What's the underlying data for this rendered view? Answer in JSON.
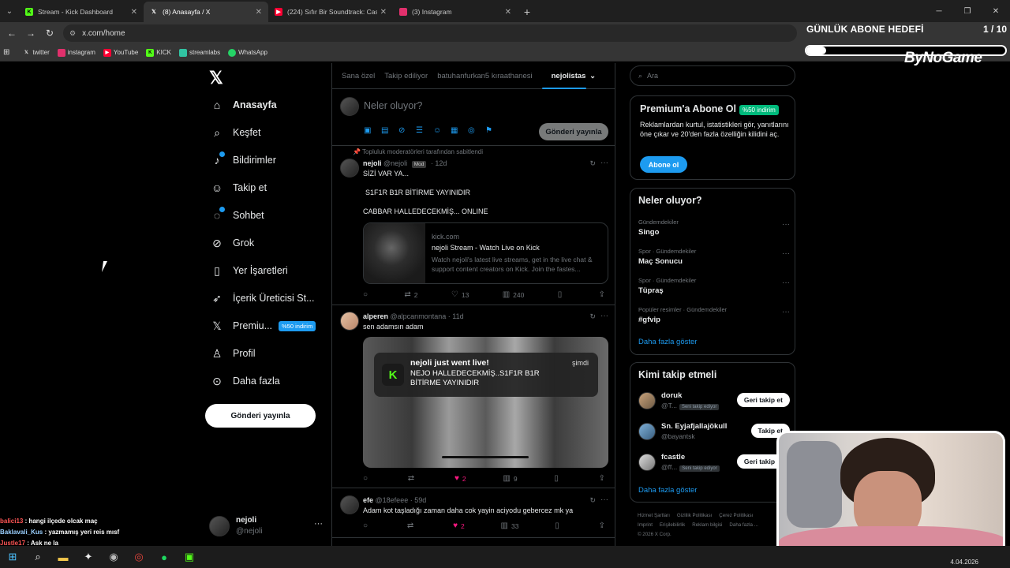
{
  "browser": {
    "tabs": [
      {
        "title": "Stream - Kick Dashboard",
        "icon": "kick-icon",
        "color": "#53fc18"
      },
      {
        "title": "(8) Anasayfa / X",
        "icon": "x-logo-icon",
        "color": "#ffffff"
      },
      {
        "title": "(224) Sıfır Bir Soundtrack: Cash",
        "icon": "youtube-icon",
        "color": "#ff0033"
      },
      {
        "title": "(3) Instagram",
        "icon": "instagram-icon",
        "color": "#e1306c"
      }
    ],
    "url": "x.com/home",
    "bookmarks": [
      "twitter",
      "instagram",
      "YouTube",
      "KICK",
      "streamlabs",
      "WhatsApp"
    ]
  },
  "overlay": {
    "goal_title": "GÜNLÜK ABONE HEDEFİ",
    "goal_count": "1 / 10",
    "goal_progress": 0.1,
    "brand": "ByNoGame"
  },
  "x": {
    "nav": [
      {
        "label": "Anasayfa",
        "icon": "home-icon"
      },
      {
        "label": "Keşfet",
        "icon": "search-icon"
      },
      {
        "label": "Bildirimler",
        "icon": "bell-icon"
      },
      {
        "label": "Takip et",
        "icon": "follow-icon"
      },
      {
        "label": "Sohbet",
        "icon": "chat-icon"
      },
      {
        "label": "Grok",
        "icon": "grok-icon"
      },
      {
        "label": "Yer İşaretleri",
        "icon": "bookmark-icon"
      },
      {
        "label": "İçerik Üreticisi St...",
        "icon": "rocket-icon"
      },
      {
        "label": "Premiu...",
        "icon": "x-logo-icon"
      },
      {
        "label": "Profil",
        "icon": "profile-icon"
      },
      {
        "label": "Daha fazla",
        "icon": "more-icon"
      }
    ],
    "premium_badge": "%50 indirim",
    "post_button": "Gönderi yayınla",
    "profile": {
      "name": "nejoli",
      "handle": "@nejoli"
    },
    "tabs": [
      "Sana özel",
      "Takip ediliyor",
      "batuhanfurkan5 kıraathanesi",
      "nejolistas"
    ],
    "compose_placeholder": "Neler oluyor?",
    "compose_button": "Gönderi yayınla",
    "posts": [
      {
        "pinned": "Topluluk moderatörleri tarafından sabitlendi",
        "name": "nejoli",
        "handle": "@nejoli",
        "badge": "Mod",
        "time": "12d",
        "lines": [
          "SİZİ VAR YA...",
          "S1F1R B1R BİTİRME YAYINIDIR",
          "CABBAR HALLEDECEKMİŞ... ONLINE"
        ],
        "card": {
          "domain": "kick.com",
          "title": "nejoli Stream - Watch Live on Kick",
          "desc": "Watch nejoli's latest live streams, get in the live chat & support content creators on Kick. Join the fastes..."
        },
        "stats": {
          "replies": "",
          "reposts": "2",
          "likes": "13",
          "views": "240"
        }
      },
      {
        "name": "alperen",
        "handle": "@alpcanmontana",
        "time": "11d",
        "lines": [
          "sen adamsın adam"
        ],
        "notif": {
          "title": "nejoli just went live!",
          "body": "NEJO HALLEDECEKMİŞ..S1F1R B1R BİTİRME YAYINIDIR",
          "when": "şimdi"
        },
        "stats": {
          "replies": "",
          "reposts": "",
          "likes": "2",
          "views": "9"
        }
      },
      {
        "name": "efe",
        "handle": "@18efeee",
        "time": "59d",
        "lines": [
          "Adam kot taşladığı zaman daha cok yayin aciyodu gebercez mk ya"
        ],
        "stats": {
          "replies": "",
          "reposts": "",
          "likes": "2",
          "views": "33"
        }
      }
    ],
    "search_placeholder": "Ara",
    "premium": {
      "title": "Premium'a Abone Ol",
      "badge": "%50 indirim",
      "desc": "Reklamlardan kurtul, istatistikleri gör, yanıtlarını öne çıkar ve 20'den fazla özelliğin kilidini aç.",
      "button": "Abone ol"
    },
    "trends_title": "Neler oluyor?",
    "trends": [
      {
        "context": "Gündemdekiler",
        "name": "Singo"
      },
      {
        "context": "Spor · Gündemdekiler",
        "name": "Maç Sonucu"
      },
      {
        "context": "Spor · Gündemdekiler",
        "name": "Tüpraş"
      },
      {
        "context": "Popüler resimler · Gündemdekiler",
        "name": "#gfvip"
      }
    ],
    "show_more": "Daha fazla göster",
    "who_title": "Kimi takip etmeli",
    "who": [
      {
        "name": "doruk",
        "handle": "@T...",
        "tag": "Seni takip ediyor",
        "button": "Geri takip et"
      },
      {
        "name": "Sn. Eyjafjallajökull",
        "handle": "@bayantsk",
        "tag": "",
        "button": "Takip et"
      },
      {
        "name": "fcastle",
        "handle": "@ff...",
        "tag": "Seni takip ediyor",
        "button": "Geri takip et"
      }
    ],
    "who_more": "Daha fazla göster",
    "footer": [
      "Hizmet Şartları",
      "Gizlilik Politikası",
      "Çerez Politikası",
      "Imprint",
      "Erişilebilirlik",
      "Reklam bilgisi",
      "Daha fazla ...",
      "© 2026 X Corp."
    ]
  },
  "chat": [
    {
      "user": "balici13",
      "msg": "hangi ilçede olcak maç"
    },
    {
      "user": "Baklavali_Kus",
      "msg": "yazmamış yeri reis mısf"
    },
    {
      "user": "Justle17",
      "msg": "Ask ne la"
    }
  ],
  "taskbar": {
    "date": "4.04.2026"
  }
}
